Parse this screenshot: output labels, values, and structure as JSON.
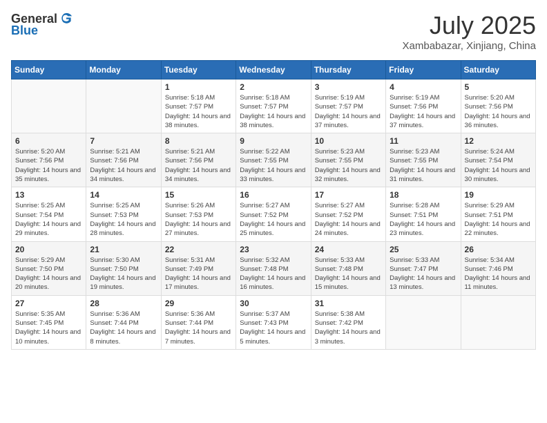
{
  "header": {
    "logo_general": "General",
    "logo_blue": "Blue",
    "month_title": "July 2025",
    "subtitle": "Xambabazar, Xinjiang, China"
  },
  "weekdays": [
    "Sunday",
    "Monday",
    "Tuesday",
    "Wednesday",
    "Thursday",
    "Friday",
    "Saturday"
  ],
  "weeks": [
    [
      {
        "day": "",
        "sunrise": "",
        "sunset": "",
        "daylight": ""
      },
      {
        "day": "",
        "sunrise": "",
        "sunset": "",
        "daylight": ""
      },
      {
        "day": "1",
        "sunrise": "Sunrise: 5:18 AM",
        "sunset": "Sunset: 7:57 PM",
        "daylight": "Daylight: 14 hours and 38 minutes."
      },
      {
        "day": "2",
        "sunrise": "Sunrise: 5:18 AM",
        "sunset": "Sunset: 7:57 PM",
        "daylight": "Daylight: 14 hours and 38 minutes."
      },
      {
        "day": "3",
        "sunrise": "Sunrise: 5:19 AM",
        "sunset": "Sunset: 7:57 PM",
        "daylight": "Daylight: 14 hours and 37 minutes."
      },
      {
        "day": "4",
        "sunrise": "Sunrise: 5:19 AM",
        "sunset": "Sunset: 7:56 PM",
        "daylight": "Daylight: 14 hours and 37 minutes."
      },
      {
        "day": "5",
        "sunrise": "Sunrise: 5:20 AM",
        "sunset": "Sunset: 7:56 PM",
        "daylight": "Daylight: 14 hours and 36 minutes."
      }
    ],
    [
      {
        "day": "6",
        "sunrise": "Sunrise: 5:20 AM",
        "sunset": "Sunset: 7:56 PM",
        "daylight": "Daylight: 14 hours and 35 minutes."
      },
      {
        "day": "7",
        "sunrise": "Sunrise: 5:21 AM",
        "sunset": "Sunset: 7:56 PM",
        "daylight": "Daylight: 14 hours and 34 minutes."
      },
      {
        "day": "8",
        "sunrise": "Sunrise: 5:21 AM",
        "sunset": "Sunset: 7:56 PM",
        "daylight": "Daylight: 14 hours and 34 minutes."
      },
      {
        "day": "9",
        "sunrise": "Sunrise: 5:22 AM",
        "sunset": "Sunset: 7:55 PM",
        "daylight": "Daylight: 14 hours and 33 minutes."
      },
      {
        "day": "10",
        "sunrise": "Sunrise: 5:23 AM",
        "sunset": "Sunset: 7:55 PM",
        "daylight": "Daylight: 14 hours and 32 minutes."
      },
      {
        "day": "11",
        "sunrise": "Sunrise: 5:23 AM",
        "sunset": "Sunset: 7:55 PM",
        "daylight": "Daylight: 14 hours and 31 minutes."
      },
      {
        "day": "12",
        "sunrise": "Sunrise: 5:24 AM",
        "sunset": "Sunset: 7:54 PM",
        "daylight": "Daylight: 14 hours and 30 minutes."
      }
    ],
    [
      {
        "day": "13",
        "sunrise": "Sunrise: 5:25 AM",
        "sunset": "Sunset: 7:54 PM",
        "daylight": "Daylight: 14 hours and 29 minutes."
      },
      {
        "day": "14",
        "sunrise": "Sunrise: 5:25 AM",
        "sunset": "Sunset: 7:53 PM",
        "daylight": "Daylight: 14 hours and 28 minutes."
      },
      {
        "day": "15",
        "sunrise": "Sunrise: 5:26 AM",
        "sunset": "Sunset: 7:53 PM",
        "daylight": "Daylight: 14 hours and 27 minutes."
      },
      {
        "day": "16",
        "sunrise": "Sunrise: 5:27 AM",
        "sunset": "Sunset: 7:52 PM",
        "daylight": "Daylight: 14 hours and 25 minutes."
      },
      {
        "day": "17",
        "sunrise": "Sunrise: 5:27 AM",
        "sunset": "Sunset: 7:52 PM",
        "daylight": "Daylight: 14 hours and 24 minutes."
      },
      {
        "day": "18",
        "sunrise": "Sunrise: 5:28 AM",
        "sunset": "Sunset: 7:51 PM",
        "daylight": "Daylight: 14 hours and 23 minutes."
      },
      {
        "day": "19",
        "sunrise": "Sunrise: 5:29 AM",
        "sunset": "Sunset: 7:51 PM",
        "daylight": "Daylight: 14 hours and 22 minutes."
      }
    ],
    [
      {
        "day": "20",
        "sunrise": "Sunrise: 5:29 AM",
        "sunset": "Sunset: 7:50 PM",
        "daylight": "Daylight: 14 hours and 20 minutes."
      },
      {
        "day": "21",
        "sunrise": "Sunrise: 5:30 AM",
        "sunset": "Sunset: 7:50 PM",
        "daylight": "Daylight: 14 hours and 19 minutes."
      },
      {
        "day": "22",
        "sunrise": "Sunrise: 5:31 AM",
        "sunset": "Sunset: 7:49 PM",
        "daylight": "Daylight: 14 hours and 17 minutes."
      },
      {
        "day": "23",
        "sunrise": "Sunrise: 5:32 AM",
        "sunset": "Sunset: 7:48 PM",
        "daylight": "Daylight: 14 hours and 16 minutes."
      },
      {
        "day": "24",
        "sunrise": "Sunrise: 5:33 AM",
        "sunset": "Sunset: 7:48 PM",
        "daylight": "Daylight: 14 hours and 15 minutes."
      },
      {
        "day": "25",
        "sunrise": "Sunrise: 5:33 AM",
        "sunset": "Sunset: 7:47 PM",
        "daylight": "Daylight: 14 hours and 13 minutes."
      },
      {
        "day": "26",
        "sunrise": "Sunrise: 5:34 AM",
        "sunset": "Sunset: 7:46 PM",
        "daylight": "Daylight: 14 hours and 11 minutes."
      }
    ],
    [
      {
        "day": "27",
        "sunrise": "Sunrise: 5:35 AM",
        "sunset": "Sunset: 7:45 PM",
        "daylight": "Daylight: 14 hours and 10 minutes."
      },
      {
        "day": "28",
        "sunrise": "Sunrise: 5:36 AM",
        "sunset": "Sunset: 7:44 PM",
        "daylight": "Daylight: 14 hours and 8 minutes."
      },
      {
        "day": "29",
        "sunrise": "Sunrise: 5:36 AM",
        "sunset": "Sunset: 7:44 PM",
        "daylight": "Daylight: 14 hours and 7 minutes."
      },
      {
        "day": "30",
        "sunrise": "Sunrise: 5:37 AM",
        "sunset": "Sunset: 7:43 PM",
        "daylight": "Daylight: 14 hours and 5 minutes."
      },
      {
        "day": "31",
        "sunrise": "Sunrise: 5:38 AM",
        "sunset": "Sunset: 7:42 PM",
        "daylight": "Daylight: 14 hours and 3 minutes."
      },
      {
        "day": "",
        "sunrise": "",
        "sunset": "",
        "daylight": ""
      },
      {
        "day": "",
        "sunrise": "",
        "sunset": "",
        "daylight": ""
      }
    ]
  ]
}
